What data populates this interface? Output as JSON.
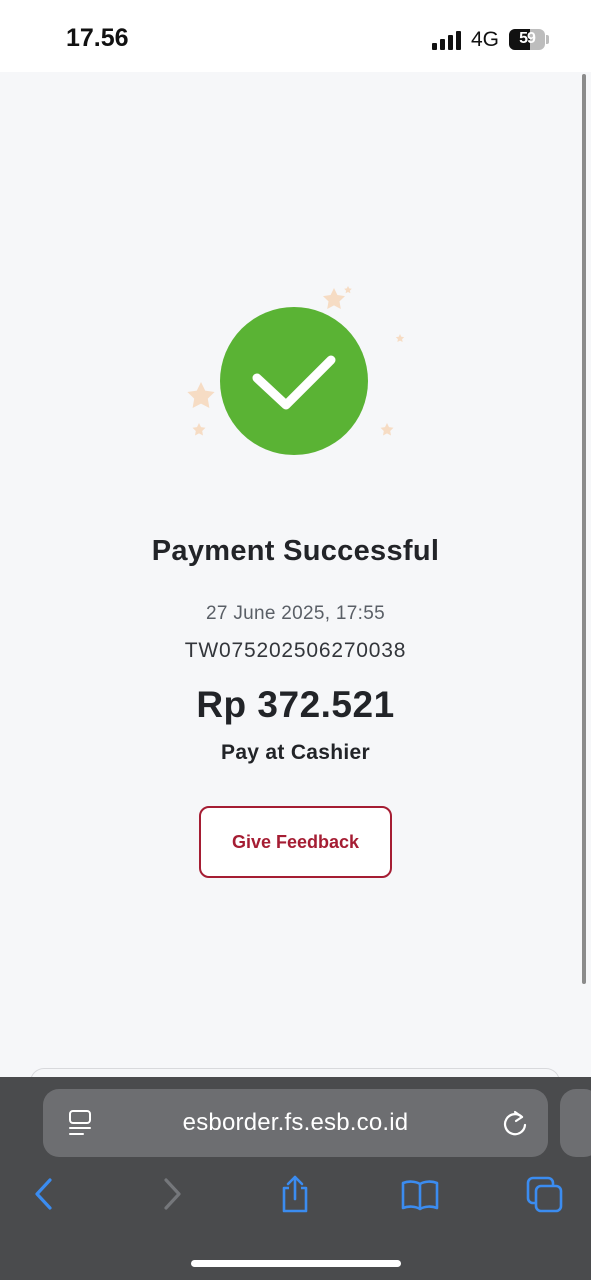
{
  "status_bar": {
    "time": "17.56",
    "network": "4G",
    "battery_text": "59",
    "battery_level": 0.59
  },
  "payment": {
    "title": "Payment Successful",
    "date": "27 June 2025, 17:55",
    "order_id": "TW075202506270038",
    "amount": "Rp 372.521",
    "method": "Pay at Cashier",
    "feedback_label": "Give Feedback"
  },
  "browser": {
    "url": "esborder.fs.esb.co.id"
  },
  "colors": {
    "success_green": "#5ab334",
    "brand_red": "#a51d33",
    "safari_blue": "#3b8cf0"
  }
}
